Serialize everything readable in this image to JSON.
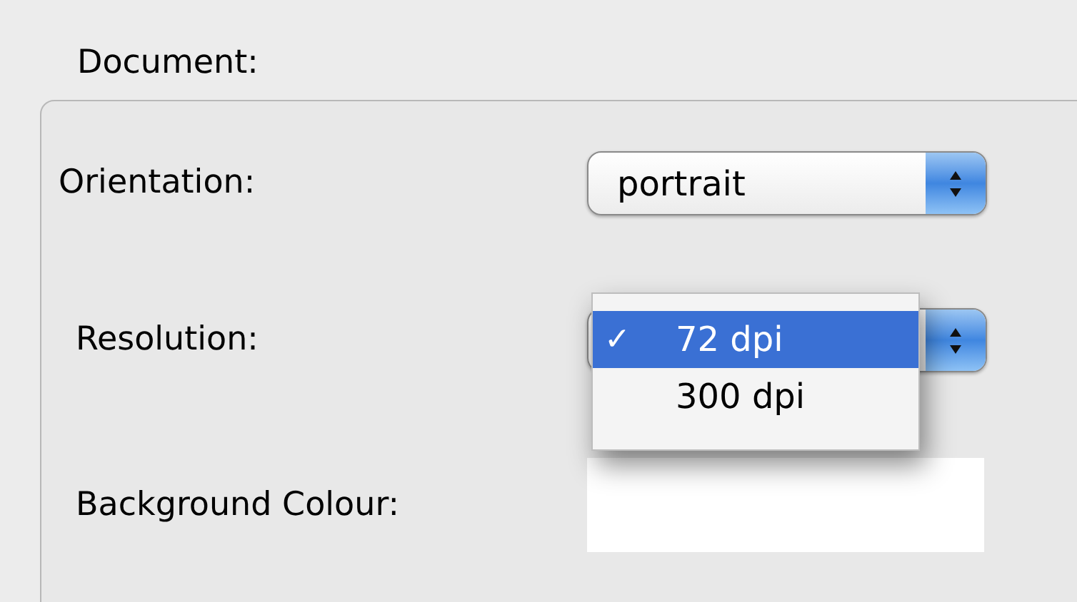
{
  "group": {
    "title": "Document:"
  },
  "fields": [
    {
      "kind": "popup",
      "label": "Orientation:",
      "value": "portrait"
    },
    {
      "kind": "popup_open",
      "label": "Resolution:",
      "options": [
        {
          "label": "72 dpi",
          "check": "✓",
          "selected": true
        },
        {
          "label": "300 dpi",
          "selected": false
        }
      ]
    },
    {
      "kind": "color",
      "label": "Background Colour:",
      "color": "#ffffff"
    }
  ]
}
